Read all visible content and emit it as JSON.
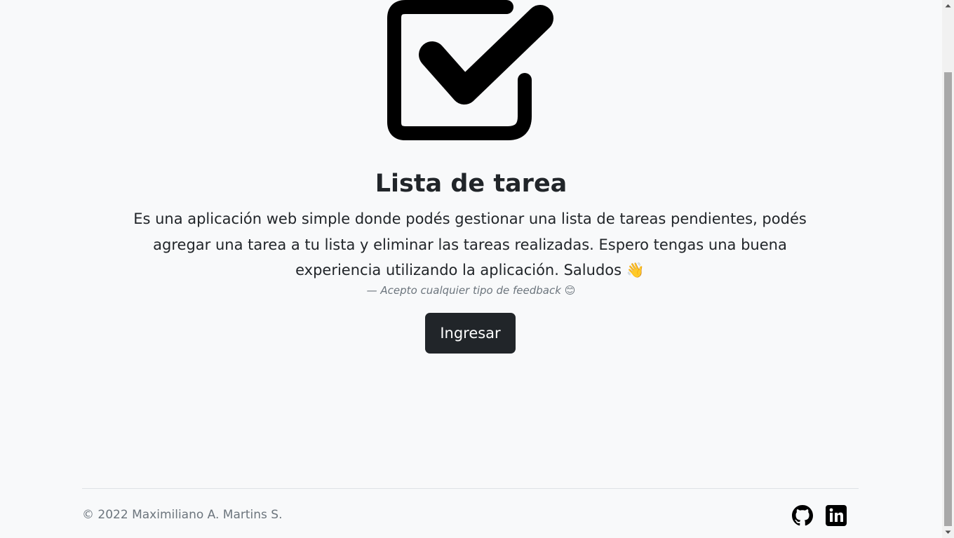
{
  "hero": {
    "icon": "check-square-icon",
    "title": "Lista de tarea",
    "description": "Es una aplicación web simple donde podés gestionar una lista de tareas pendientes, podés agregar una tarea a tu lista y eliminar las tareas realizadas. Espero tengas una buena experiencia utilizando la aplicación. Saludos 👋",
    "feedback": "— Acepto cualquier tipo de feedback 😊",
    "button_label": "Ingresar"
  },
  "footer": {
    "copyright": "© 2022 Maximiliano A. Martins S.",
    "links": [
      {
        "icon": "github-icon"
      },
      {
        "icon": "linkedin-icon"
      }
    ]
  },
  "colors": {
    "background": "#f8f9fa",
    "text": "#212529",
    "muted": "#6c757d",
    "button": "#212529"
  }
}
